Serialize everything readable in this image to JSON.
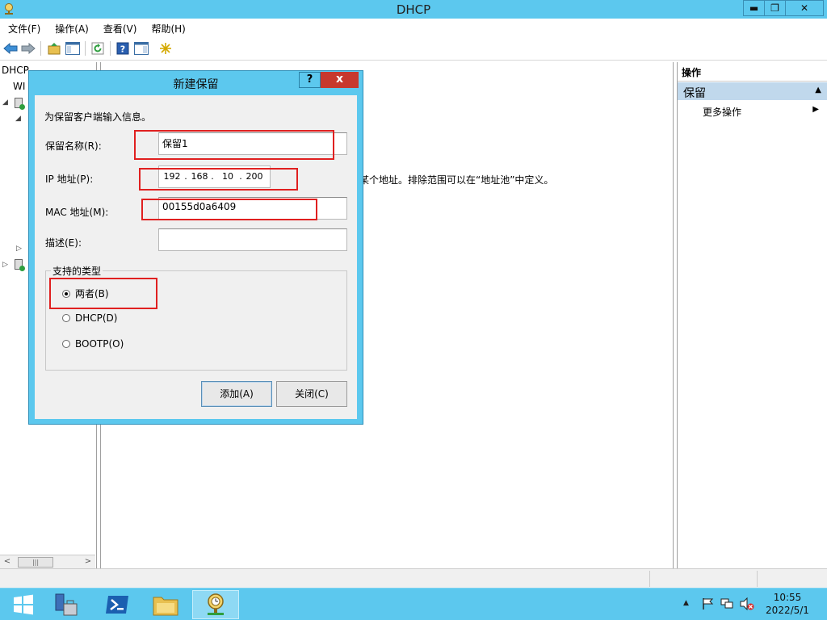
{
  "window": {
    "title": "DHCP",
    "minimize_glyph": "▬",
    "maximize_glyph": "❐",
    "close_glyph": "✕"
  },
  "menu": [
    "文件(F)",
    "操作(A)",
    "查看(V)",
    "帮助(H)"
  ],
  "tree": {
    "root": "DHCP",
    "server": "WI"
  },
  "content": {
    "visible_text": "某个地址。排除范围可以在“地址池”中定义。"
  },
  "actions_pane": {
    "header": "操作",
    "section": "保留",
    "more": "更多操作"
  },
  "dialog": {
    "title": "新建保留",
    "help_label": "?",
    "close_label": "x",
    "intro": "为保留客户端输入信息。",
    "name_label": "保留名称(R):",
    "name_value": "保留1",
    "ip_label": "IP 地址(P):",
    "ip_octets": [
      "192",
      "168",
      "10",
      "200"
    ],
    "ip_dot": ".",
    "mac_label": "MAC 地址(M):",
    "mac_value": "00155d0a6409",
    "desc_label": "描述(E):",
    "desc_value": "",
    "group_title": "支持的类型",
    "options": [
      {
        "label": "两者(B)",
        "selected": true
      },
      {
        "label": "DHCP(D)",
        "selected": false
      },
      {
        "label": "BOOTP(O)",
        "selected": false
      }
    ],
    "add_button": "添加(A)",
    "close_button": "关闭(C)"
  },
  "taskbar": {
    "time": "10:55",
    "date": "2022/5/1"
  },
  "colors": {
    "chrome": "#5cc8ee",
    "close_red": "#c7382d",
    "highlight_red": "#e02020",
    "section_blue": "#c0d8ec"
  }
}
